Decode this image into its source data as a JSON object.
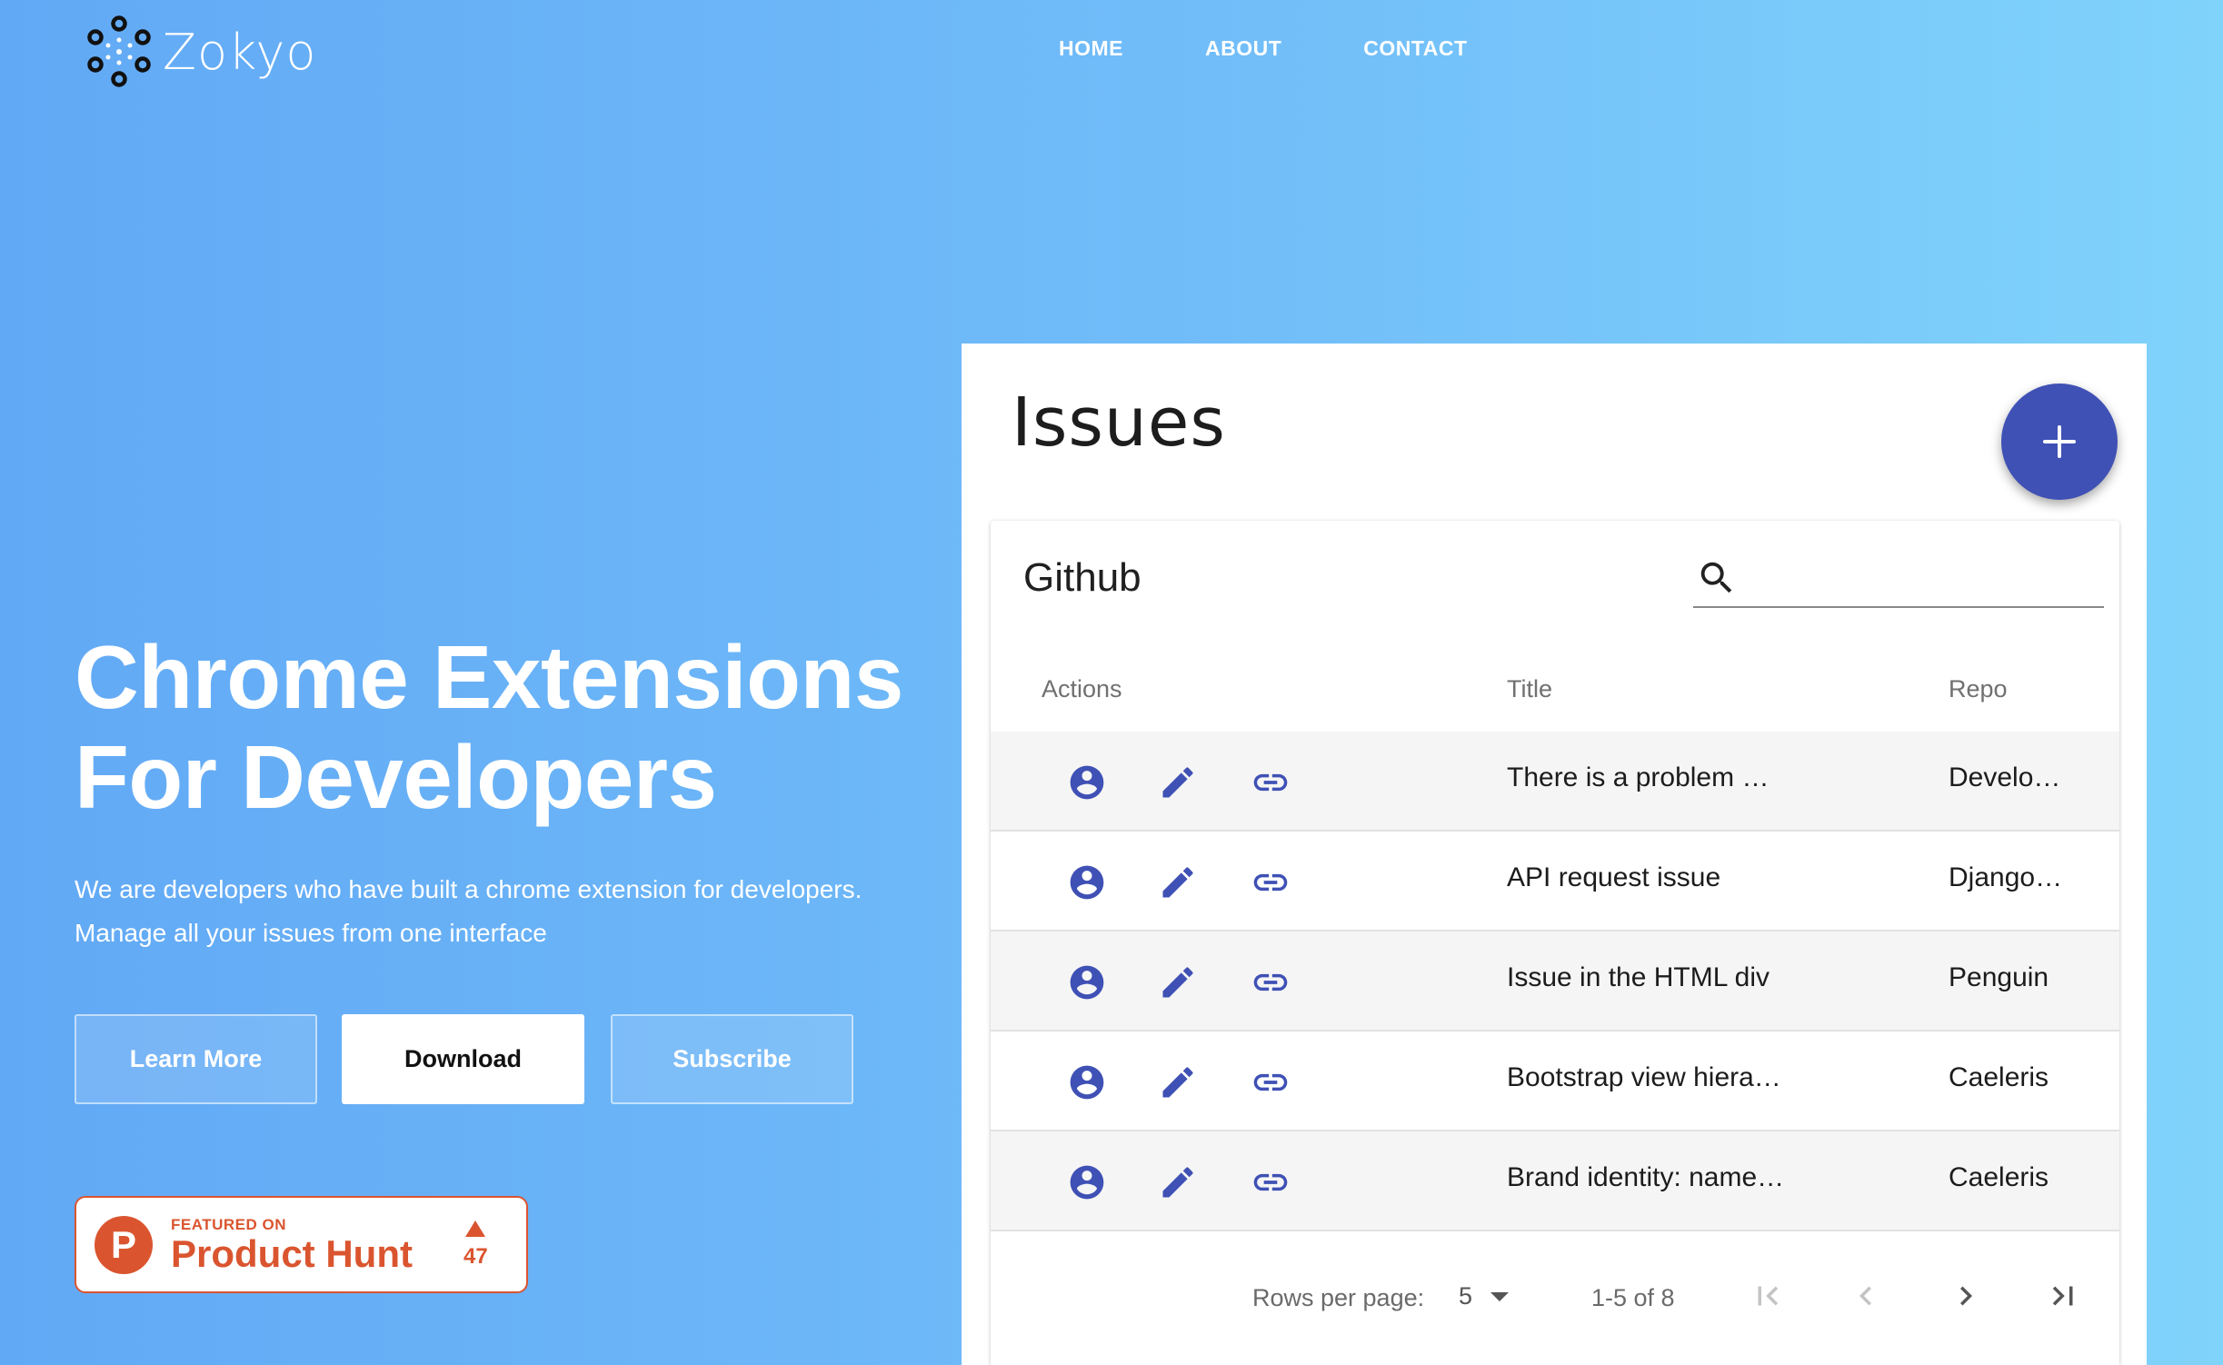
{
  "brand": {
    "name": "Zokyo"
  },
  "nav": {
    "home": "HOME",
    "about": "ABOUT",
    "contact": "CONTACT"
  },
  "hero": {
    "title_line1": "Chrome Extensions",
    "title_line2": "For Developers",
    "sub_line1": "We are developers who have built a chrome extension for developers.",
    "sub_line2": "Manage all your issues from one interface",
    "learn_more": "Learn More",
    "download": "Download",
    "subscribe": "Subscribe"
  },
  "product_hunt": {
    "featured": "FEATURED ON",
    "name": "Product Hunt",
    "badge_letter": "P",
    "votes": "47"
  },
  "issues": {
    "title": "Issues",
    "table_title": "Github",
    "search_value": "",
    "columns": {
      "actions": "Actions",
      "title": "Title",
      "repo": "Repo"
    },
    "rows": [
      {
        "title": "There is a problem …",
        "repo": "Develo…"
      },
      {
        "title": "API request issue",
        "repo": "Django…"
      },
      {
        "title": "Issue in the HTML div",
        "repo": "Penguin"
      },
      {
        "title": "Bootstrap view hiera…",
        "repo": "Caeleris"
      },
      {
        "title": "Brand identity: name…",
        "repo": "Caeleris"
      }
    ],
    "pagination": {
      "rows_per_page_label": "Rows per page:",
      "rows_per_page": "5",
      "range": "1-5 of 8"
    }
  },
  "colors": {
    "accent": "#3f51b5",
    "product_hunt": "#da552f"
  },
  "icons": [
    "search-icon",
    "account-circle-icon",
    "edit-pencil-icon",
    "link-icon",
    "add-icon",
    "first-page-icon",
    "chevron-left-icon",
    "chevron-right-icon",
    "last-page-icon"
  ]
}
